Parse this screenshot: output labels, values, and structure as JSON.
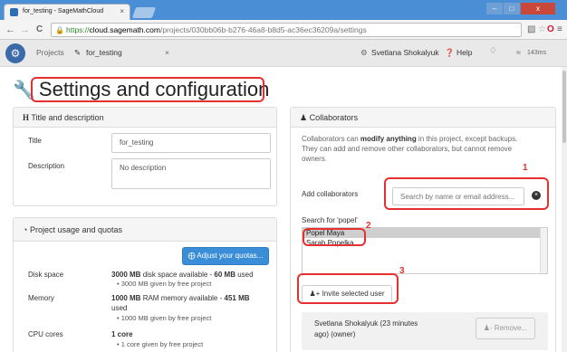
{
  "browser": {
    "tab_title": "for_testing - SageMathCloud",
    "tab_close": "×",
    "window_controls": {
      "minimize": "–",
      "maximize": "□",
      "close": "x"
    },
    "url": {
      "scheme": "https://",
      "domain": "cloud.sagemath.com",
      "path": "/projects/030bb06b-b276-46a8-b8d5-ac36ec36209a/settings"
    },
    "nav": {
      "back": "←",
      "forward": "→",
      "reload": "C"
    }
  },
  "appnav": {
    "projects_label": "Projects",
    "project_tab_label": "for_testing",
    "project_tab_close": "×",
    "user_name": "Svetlana Shokalyuk",
    "help_label": "Help",
    "ping": "143ms"
  },
  "page": {
    "title": "Settings and configuration"
  },
  "title_desc": {
    "header": "Title and description",
    "title_label": "Title",
    "title_value": "for_testing",
    "description_label": "Description",
    "description_value": "No description"
  },
  "usage": {
    "header": "Project usage and quotas",
    "adjust_button": "Adjust your quotas...",
    "rows": [
      {
        "label": "Disk space",
        "value_bold": "3000 MB",
        "value_rest": " disk space available - ",
        "used_bold": "60 MB",
        "used_rest": " used",
        "bullet": "3000 MB given by free project"
      },
      {
        "label": "Memory",
        "value_bold": "1000 MB",
        "value_rest": " RAM memory available - ",
        "used_bold": "451 MB",
        "used_rest": "",
        "used_line2": "used",
        "bullet": "1000 MB given by free project"
      },
      {
        "label": "CPU cores",
        "value_bold": "1 core",
        "bullet": "1 core given by free project"
      }
    ]
  },
  "collab": {
    "header": "Collaborators",
    "intro_1": "Collaborators can ",
    "intro_bold": "modify anything",
    "intro_2": " in this project, except backups.",
    "intro_line2": "They can add and remove other collaborators, but cannot remove",
    "intro_line3": "owners.",
    "add_label": "Add collaborators",
    "search_placeholder": "Search by name or email address...",
    "search_results_label": "Search for 'popel'",
    "results": [
      "Popel Maya",
      "Sarah Popelka"
    ],
    "invite_button": "Invite selected user",
    "current": {
      "name_line1": "Svetlana Shokalyuk (23 minutes",
      "name_line2": "ago) (owner)",
      "remove_button": "Remove..."
    }
  },
  "annotations": {
    "n1": "1",
    "n2": "2",
    "n3": "3"
  }
}
